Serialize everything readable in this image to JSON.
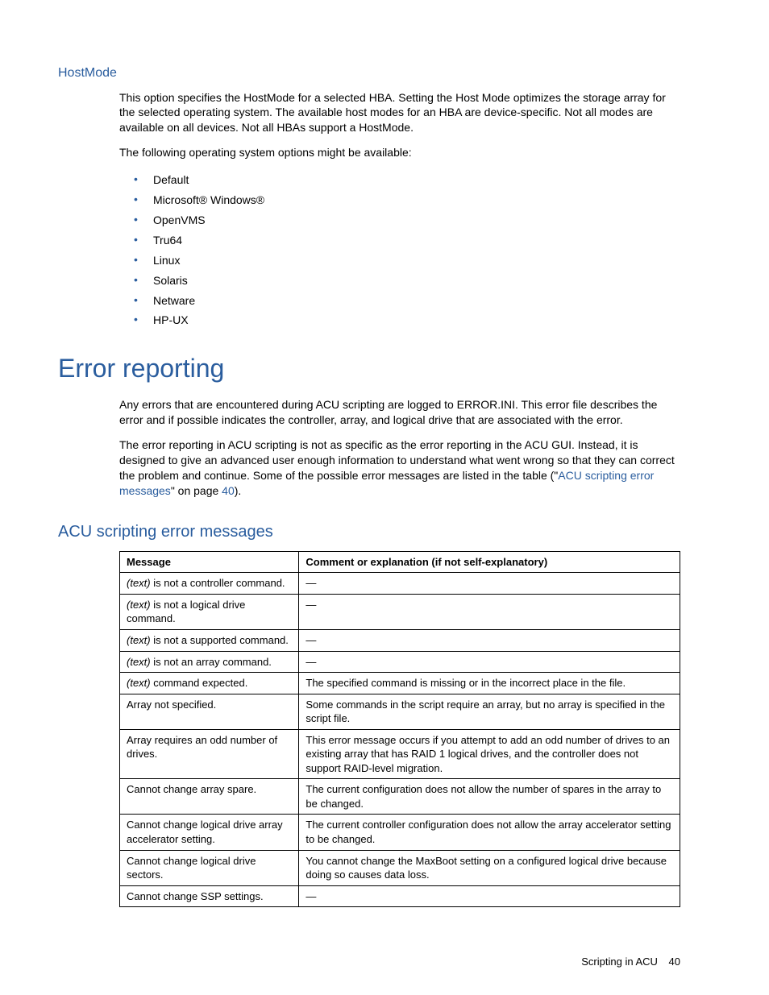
{
  "hostmode": {
    "title": "HostMode",
    "para1": "This option specifies the HostMode for a selected HBA. Setting the Host Mode optimizes the storage array for the selected operating system. The available host modes for an HBA are device-specific. Not all modes are available on all devices. Not all HBAs support a HostMode.",
    "para2": "The following operating system options might be available:",
    "os_list": [
      "Default",
      "Microsoft® Windows®",
      "OpenVMS",
      "Tru64",
      "Linux",
      "Solaris",
      "Netware",
      "HP-UX"
    ]
  },
  "error_reporting": {
    "title": "Error reporting",
    "para1": "Any errors that are encountered during ACU scripting are logged to ERROR.INI. This error file describes the error and if possible indicates the controller, array, and logical drive that are associated with the error.",
    "para2_a": "The error reporting in ACU scripting is not as specific as the error reporting in the ACU GUI. Instead, it is designed to give an advanced user enough information to understand what went wrong so that they can correct the problem and continue. Some of the possible error messages are listed in the table (\"",
    "para2_link1": "ACU scripting error messages",
    "para2_b": "\" on page ",
    "para2_link2": "40",
    "para2_c": ")."
  },
  "acu_table": {
    "title": "ACU scripting error messages",
    "headers": {
      "msg": "Message",
      "cmt": "Comment or explanation (if not self-explanatory)"
    },
    "italic_prefix": "(text)",
    "rows": [
      {
        "msg_suffix": " is not a controller command.",
        "cmt": "—",
        "has_prefix": true
      },
      {
        "msg_suffix": " is not a logical drive command.",
        "cmt": "—",
        "has_prefix": true
      },
      {
        "msg_suffix": " is not a supported command.",
        "cmt": "—",
        "has_prefix": true
      },
      {
        "msg_suffix": " is not an array command.",
        "cmt": "—",
        "has_prefix": true
      },
      {
        "msg_suffix": " command expected.",
        "cmt": "The specified command is missing or in the incorrect place in the file.",
        "has_prefix": true
      },
      {
        "msg_suffix": "Array not specified.",
        "cmt": "Some commands in the script require an array, but no array is specified in the script file.",
        "has_prefix": false
      },
      {
        "msg_suffix": "Array requires an odd number of drives.",
        "cmt": "This error message occurs if you attempt to add an odd number of drives to an existing array that has RAID 1 logical drives, and the controller does not support RAID-level migration.",
        "has_prefix": false
      },
      {
        "msg_suffix": "Cannot change array spare.",
        "cmt": "The current configuration does not allow the number of spares in the array to be changed.",
        "has_prefix": false
      },
      {
        "msg_suffix": "Cannot change logical drive array accelerator setting.",
        "cmt": "The current controller configuration does not allow the array accelerator setting to be changed.",
        "has_prefix": false
      },
      {
        "msg_suffix": "Cannot change logical drive sectors.",
        "cmt": "You cannot change the MaxBoot setting on a configured logical drive because doing so causes data loss.",
        "has_prefix": false
      },
      {
        "msg_suffix": "Cannot change SSP settings.",
        "cmt": "—",
        "has_prefix": false
      }
    ]
  },
  "footer": {
    "section": "Scripting in ACU",
    "page": "40"
  }
}
